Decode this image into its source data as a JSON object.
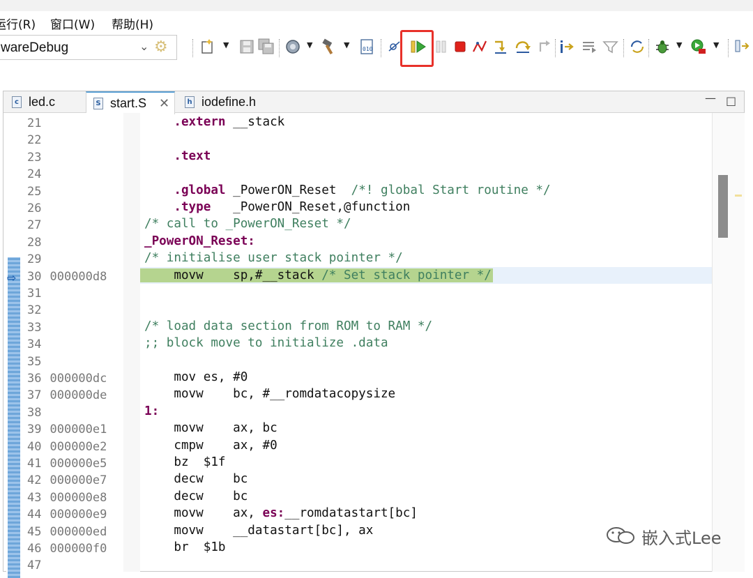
{
  "menu": {
    "items": [
      {
        "label": "运行(R)"
      },
      {
        "label": "窗口(W)"
      },
      {
        "label": "帮助(H)"
      }
    ]
  },
  "toolbar": {
    "config_combo_value": "wareDebug",
    "resume_button_highlight": "#e8312a"
  },
  "tabs": [
    {
      "label": "led.c",
      "icon": "c",
      "active": false
    },
    {
      "label": "start.S",
      "icon": "S",
      "active": true
    },
    {
      "label": "iodefine.h",
      "icon": "h",
      "active": false
    }
  ],
  "editor": {
    "current_line": 30,
    "lines": [
      {
        "num": "21",
        "addr": "",
        "segments": [
          {
            "t": "    ",
            "c": "tx"
          },
          {
            "t": ".extern",
            "c": "kw"
          },
          {
            "t": " __stack",
            "c": "tx"
          }
        ]
      },
      {
        "num": "22",
        "addr": "",
        "segments": []
      },
      {
        "num": "23",
        "addr": "",
        "segments": [
          {
            "t": "    ",
            "c": "tx"
          },
          {
            "t": ".text",
            "c": "kw"
          }
        ]
      },
      {
        "num": "24",
        "addr": "",
        "segments": []
      },
      {
        "num": "25",
        "addr": "",
        "segments": [
          {
            "t": "    ",
            "c": "tx"
          },
          {
            "t": ".global",
            "c": "kw"
          },
          {
            "t": " _PowerON_Reset  ",
            "c": "tx"
          },
          {
            "t": "/*! global Start routine */",
            "c": "cm"
          }
        ]
      },
      {
        "num": "26",
        "addr": "",
        "segments": [
          {
            "t": "    ",
            "c": "tx"
          },
          {
            "t": ".type",
            "c": "kw"
          },
          {
            "t": "   _PowerON_Reset,@function",
            "c": "tx"
          }
        ]
      },
      {
        "num": "27",
        "addr": "",
        "segments": [
          {
            "t": "/* call to _PowerON_Reset */",
            "c": "cm"
          }
        ]
      },
      {
        "num": "28",
        "addr": "",
        "segments": [
          {
            "t": "_PowerON_Reset:",
            "c": "kw"
          }
        ]
      },
      {
        "num": "29",
        "addr": "",
        "segments": [
          {
            "t": "/* initialise user stack pointer */",
            "c": "cm"
          }
        ]
      },
      {
        "num": "30",
        "addr": "000000d8",
        "segments": [
          {
            "t": "    movw    sp,#__stack ",
            "c": "tx"
          },
          {
            "t": "/* Set stack pointer */",
            "c": "cm"
          }
        ]
      },
      {
        "num": "31",
        "addr": "",
        "segments": []
      },
      {
        "num": "32",
        "addr": "",
        "segments": []
      },
      {
        "num": "33",
        "addr": "",
        "segments": [
          {
            "t": "/* load data section from ROM to RAM */",
            "c": "cm"
          }
        ]
      },
      {
        "num": "34",
        "addr": "",
        "segments": [
          {
            "t": ";; block move to initialize .data",
            "c": "cm"
          }
        ]
      },
      {
        "num": "35",
        "addr": "",
        "segments": []
      },
      {
        "num": "36",
        "addr": "000000dc",
        "segments": [
          {
            "t": "    mov es, #0",
            "c": "tx"
          }
        ]
      },
      {
        "num": "37",
        "addr": "000000de",
        "segments": [
          {
            "t": "    movw    bc, #__romdatacopysize",
            "c": "tx"
          }
        ]
      },
      {
        "num": "38",
        "addr": "",
        "segments": [
          {
            "t": "1:",
            "c": "kw"
          }
        ]
      },
      {
        "num": "39",
        "addr": "000000e1",
        "segments": [
          {
            "t": "    movw    ax, bc",
            "c": "tx"
          }
        ]
      },
      {
        "num": "40",
        "addr": "000000e2",
        "segments": [
          {
            "t": "    cmpw    ax, #0",
            "c": "tx"
          }
        ]
      },
      {
        "num": "41",
        "addr": "000000e5",
        "segments": [
          {
            "t": "    bz  $1f",
            "c": "tx"
          }
        ]
      },
      {
        "num": "42",
        "addr": "000000e7",
        "segments": [
          {
            "t": "    decw    bc",
            "c": "tx"
          }
        ]
      },
      {
        "num": "43",
        "addr": "000000e8",
        "segments": [
          {
            "t": "    decw    bc",
            "c": "tx"
          }
        ]
      },
      {
        "num": "44",
        "addr": "000000e9",
        "segments": [
          {
            "t": "    movw    ax, ",
            "c": "tx"
          },
          {
            "t": "es:",
            "c": "kw"
          },
          {
            "t": "__romdatastart[bc]",
            "c": "tx"
          }
        ]
      },
      {
        "num": "45",
        "addr": "000000ed",
        "segments": [
          {
            "t": "    movw    __datastart[bc], ax",
            "c": "tx"
          }
        ]
      },
      {
        "num": "46",
        "addr": "000000f0",
        "segments": [
          {
            "t": "    br  $1b",
            "c": "tx"
          }
        ]
      },
      {
        "num": "47",
        "addr": "",
        "segments": []
      }
    ]
  },
  "watermark": {
    "text": "嵌入式Lee"
  }
}
